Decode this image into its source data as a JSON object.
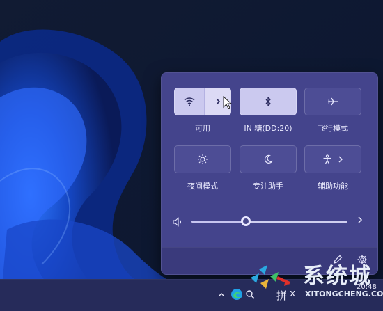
{
  "quick_settings": {
    "tiles": [
      {
        "id": "wifi",
        "label": "可用",
        "active": true,
        "icon": "wifi-icon"
      },
      {
        "id": "bluetooth",
        "label": "IN 糖(DD:20)",
        "active": true,
        "icon": "bluetooth-icon"
      },
      {
        "id": "airplane",
        "label": "飞行模式",
        "active": false,
        "icon": "airplane-icon"
      },
      {
        "id": "night-light",
        "label": "夜间模式",
        "active": false,
        "icon": "night-light-icon"
      },
      {
        "id": "focus-assist",
        "label": "专注助手",
        "active": false,
        "icon": "moon-icon"
      },
      {
        "id": "accessibility",
        "label": "辅助功能",
        "active": false,
        "icon": "accessibility-icon"
      }
    ],
    "volume": {
      "level_percent": 35,
      "icon": "speaker-icon"
    },
    "footer": {
      "edit_icon": "pencil-icon",
      "settings_icon": "gear-icon"
    }
  },
  "taskbar": {
    "ime_label": "拼",
    "partial_label": "x",
    "time_fragment": "20:48",
    "icons": [
      "chevron-up-icon",
      "edge-icon",
      "search-icon"
    ]
  },
  "watermark": {
    "brand_text": "系统城",
    "site_text": "XITONGCHENG.COM"
  },
  "colors": {
    "panel_bg": "#44448c",
    "tile_on": "#cbc9ef",
    "tile_off": "#4d4d95",
    "taskbar_bg": "#262b5a",
    "wallpaper_bg": "#0b1630",
    "bloom_blue": "#1d5bd8"
  }
}
